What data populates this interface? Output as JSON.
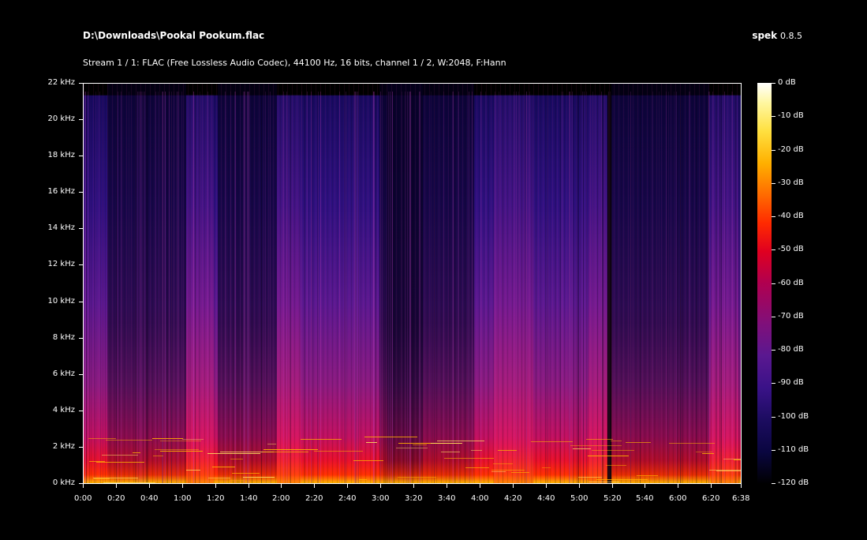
{
  "window": {
    "file_path": "D:\\Downloads\\Pookal Pookum.flac",
    "app_name": "spek",
    "app_version": "0.8.5",
    "stream_info": "Stream 1 / 1: FLAC (Free Lossless Audio Codec), 44100 Hz, 16 bits, channel 1 / 2, W:2048, F:Hann"
  },
  "axes": {
    "y_labels": [
      "22 kHz",
      "20 kHz",
      "18 kHz",
      "16 kHz",
      "14 kHz",
      "12 kHz",
      "10 kHz",
      "8 kHz",
      "6 kHz",
      "4 kHz",
      "2 kHz",
      "0 kHz"
    ],
    "x_labels": [
      "0:00",
      "0:20",
      "0:40",
      "1:00",
      "1:20",
      "1:40",
      "2:00",
      "2:20",
      "2:40",
      "3:00",
      "3:20",
      "3:40",
      "4:00",
      "4:20",
      "4:40",
      "5:00",
      "5:20",
      "5:40",
      "6:00",
      "6:20",
      "6:38"
    ],
    "colorbar_labels": [
      "0 dB",
      "-10 dB",
      "-20 dB",
      "-30 dB",
      "-40 dB",
      "-50 dB",
      "-60 dB",
      "-70 dB",
      "-80 dB",
      "-90 dB",
      "-100 dB",
      "-110 dB",
      "-120 dB"
    ]
  },
  "spectrogram": {
    "freq_range_khz": [
      0,
      22
    ],
    "time_range_s": [
      0,
      398
    ],
    "db_range": [
      -120,
      0
    ],
    "lowpass_cutoff_khz": 21.5
  }
}
